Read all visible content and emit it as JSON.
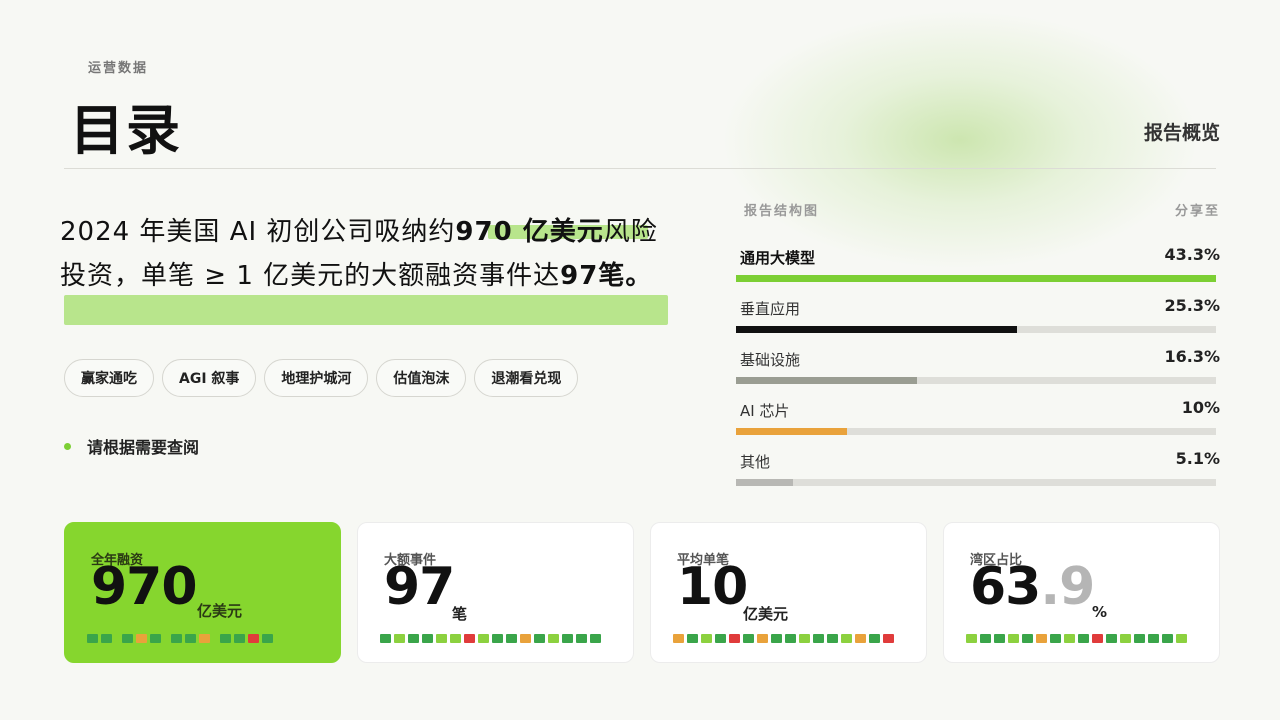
{
  "header": {
    "kicker": "运营数据",
    "title": "目录",
    "overview": "报告概览"
  },
  "headline": {
    "part1": "2024 年美国 AI 初创公司吸纳约",
    "bold1": "970 亿美元",
    "part2": "风险投资，单笔 ≥ 1 亿美元的大额融资事件达",
    "bold2": "97",
    "part3": "笔。"
  },
  "tags": [
    "赢家通吃",
    "AGI 叙事",
    "地理护城河",
    "估值泡沫",
    "退潮看兑现"
  ],
  "note": "请根据需要查阅",
  "structure": {
    "title": "报告结构图",
    "share": "分享至",
    "items": [
      {
        "label": "通用大模型",
        "value": "43.3%",
        "pct": 100,
        "color": "#7ccf34"
      },
      {
        "label": "垂直应用",
        "value": "25.3%",
        "pct": 58.5,
        "color": "#111111"
      },
      {
        "label": "基础设施",
        "value": "16.3%",
        "pct": 37.7,
        "color": "#9a9d92"
      },
      {
        "label": "AI 芯片",
        "value": "10%",
        "pct": 23.1,
        "color": "#e9a23b"
      },
      {
        "label": "其他",
        "value": "5.1%",
        "pct": 11.8,
        "color": "#b8b8b4"
      }
    ]
  },
  "cards": [
    {
      "label": "全年融资",
      "number": "970",
      "unit": "亿美元"
    },
    {
      "label": "大额事件",
      "number": "97",
      "unit": "笔"
    },
    {
      "label": "平均单笔",
      "number": "10",
      "unit": "亿美元"
    },
    {
      "label": "湾区占比",
      "number": "63",
      "decimal": ".9",
      "unit": "%"
    }
  ],
  "colors": {
    "green": "#7ccf34",
    "bg": "#f7f8f4"
  }
}
